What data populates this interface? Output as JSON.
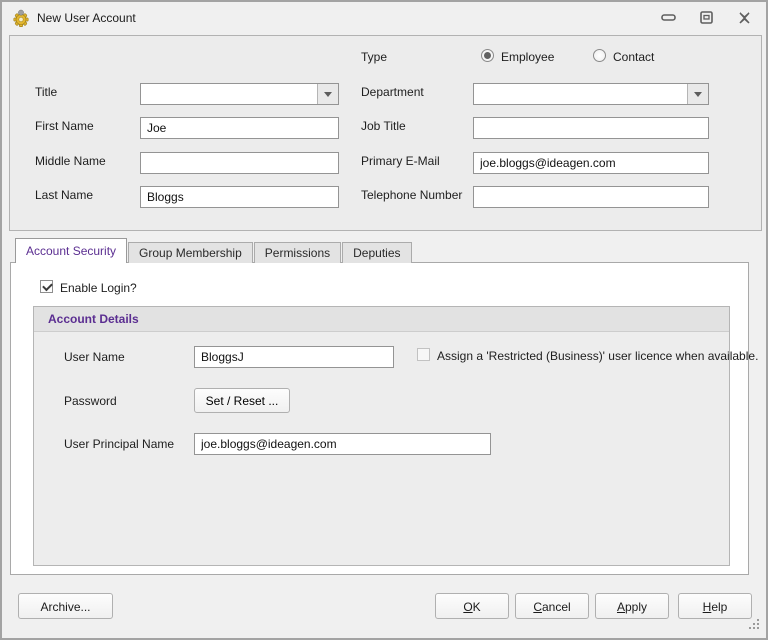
{
  "window": {
    "title": "New User Account"
  },
  "fields": {
    "title": {
      "label": "Title",
      "value": ""
    },
    "first_name": {
      "label": "First Name",
      "value": "Joe"
    },
    "middle_name": {
      "label": "Middle Name",
      "value": ""
    },
    "last_name": {
      "label": "Last Name",
      "value": "Bloggs"
    },
    "type": {
      "label": "Type",
      "options": [
        {
          "label": "Employee",
          "selected": true
        },
        {
          "label": "Contact",
          "selected": false
        }
      ]
    },
    "department": {
      "label": "Department",
      "value": ""
    },
    "job_title": {
      "label": "Job Title",
      "value": ""
    },
    "primary_email": {
      "label": "Primary E-Mail",
      "value": "joe.bloggs@ideagen.com"
    },
    "telephone": {
      "label": "Telephone Number",
      "value": ""
    }
  },
  "tabs": [
    {
      "label": "Account Security",
      "active": true
    },
    {
      "label": "Group Membership",
      "active": false
    },
    {
      "label": "Permissions",
      "active": false
    },
    {
      "label": "Deputies",
      "active": false
    }
  ],
  "account_security": {
    "enable_login": {
      "label": "Enable Login?",
      "checked": true
    },
    "group_title": "Account Details",
    "user_name": {
      "label": "User Name",
      "value": "BloggsJ"
    },
    "restricted_licence": {
      "label": "Assign a 'Restricted (Business)' user licence when available.",
      "checked": false
    },
    "password": {
      "label": "Password",
      "button_label": "Set / Reset ..."
    },
    "upn": {
      "label": "User Principal Name",
      "value": "joe.bloggs@ideagen.com"
    }
  },
  "footer": {
    "archive": "Archive...",
    "ok": "OK",
    "cancel": "Cancel",
    "apply": "Apply",
    "help": "Help"
  },
  "colors": {
    "accent_purple": "#5b2e91",
    "dialog_bg": "#f0f0f0",
    "panel_bg": "#ececec",
    "white": "#ffffff",
    "border": "#a9a9a9"
  }
}
